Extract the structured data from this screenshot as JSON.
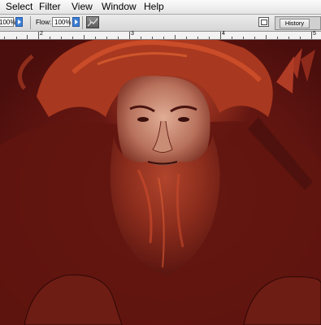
{
  "menu": [
    "Select",
    "Filter",
    "View",
    "Window",
    "Help"
  ],
  "options": {
    "opacity_value": "100%",
    "flow_label": "Flow:",
    "flow_value": "100%"
  },
  "palette_well": {
    "tab_label": "History"
  },
  "ruler": {
    "labels": [
      "2",
      "3",
      "4",
      "5"
    ]
  },
  "colors": {
    "canvas_dark": "#5e1410",
    "hair_orange": "#c8492a",
    "skin": "#d6a08a",
    "beard": "#8c2d1d"
  }
}
